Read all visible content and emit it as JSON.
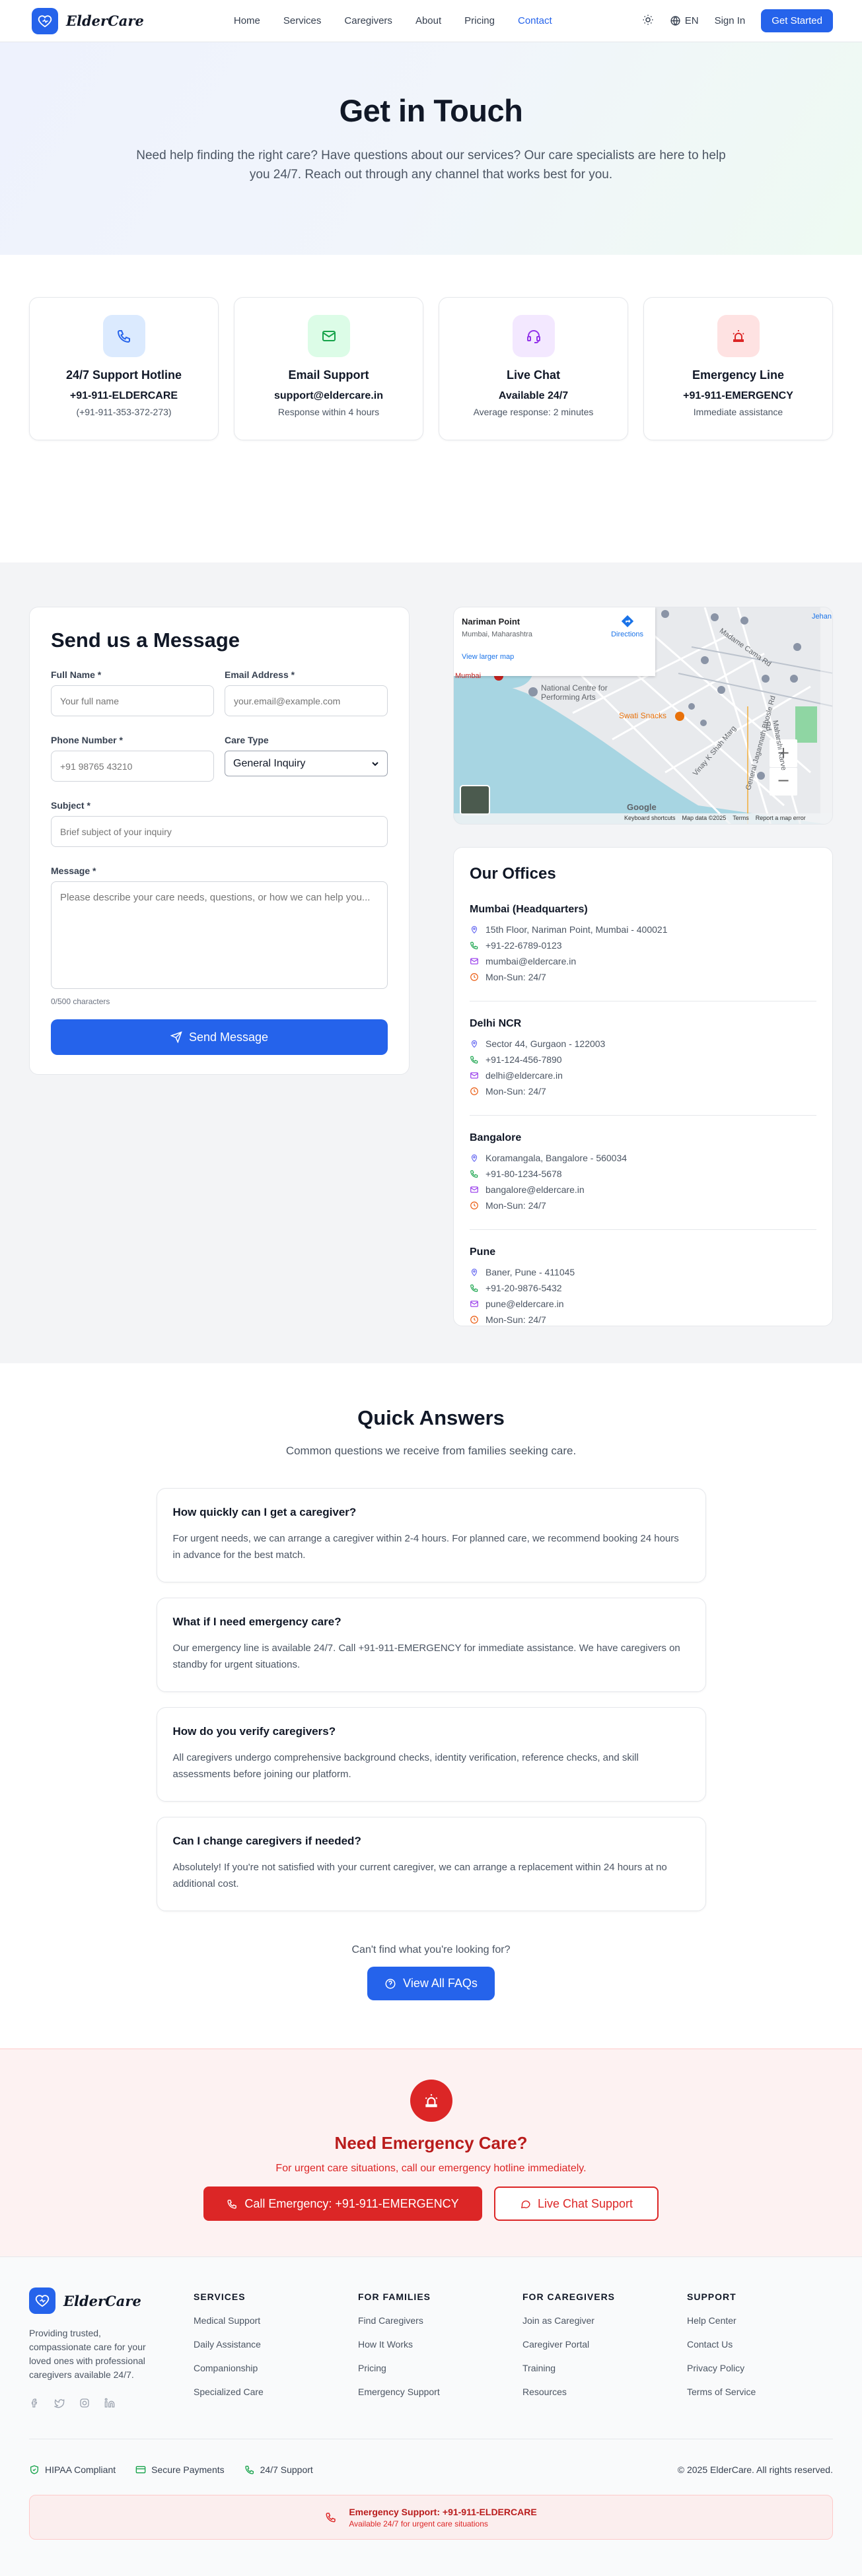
{
  "nav": {
    "brand": "ElderCare",
    "links": [
      "Home",
      "Services",
      "Caregivers",
      "About",
      "Pricing",
      "Contact"
    ],
    "lang": "EN",
    "signin": "Sign In",
    "cta": "Get Started"
  },
  "hero": {
    "title": "Get in Touch",
    "subtitle": "Need help finding the right care? Have questions about our services? Our care specialists are here to help you 24/7. Reach out through any channel that works best for you."
  },
  "cards": [
    {
      "title": "24/7 Support Hotline",
      "value": "+91-911-ELDERCARE",
      "sub": "(+91-911-353-372-273)",
      "icon": "phone-icon",
      "bg": "#dbeafe",
      "color": "#2563eb"
    },
    {
      "title": "Email Support",
      "value": "support@eldercare.in",
      "sub": "Response within 4 hours",
      "icon": "mail-icon",
      "bg": "#dcfce7",
      "color": "#16a34a"
    },
    {
      "title": "Live Chat",
      "value": "Available 24/7",
      "sub": "Average response: 2 minutes",
      "icon": "headset-icon",
      "bg": "#f3e8ff",
      "color": "#9333ea"
    },
    {
      "title": "Emergency Line",
      "value": "+91-911-EMERGENCY",
      "sub": "Immediate assistance",
      "icon": "siren-icon",
      "bg": "#fee2e2",
      "color": "#dc2626"
    }
  ],
  "form": {
    "title": "Send us a Message",
    "full_name_label": "Full Name *",
    "full_name_ph": "Your full name",
    "email_label": "Email Address *",
    "email_ph": "your.email@example.com",
    "phone_label": "Phone Number *",
    "phone_ph": "+91 98765 43210",
    "care_label": "Care Type",
    "care_value": "General Inquiry",
    "subject_label": "Subject *",
    "subject_ph": "Brief subject of your inquiry",
    "message_label": "Message *",
    "message_ph": "Please describe your care needs, questions, or how we can help you...",
    "counter": "0/500 characters",
    "send": "Send Message"
  },
  "map": {
    "place": "Nariman Point",
    "region": "Mumbai, Maharashtra",
    "directions": "Directions",
    "larger": "View larger map",
    "ncpa": "National Centre for Performing Arts",
    "swati": "Swati Snacks",
    "road1": "Madame Cama Rd",
    "road2": "Maharshi Karve Rd",
    "road3": "General Jagannath Bhosle Rd",
    "road4": "Vinay K Shah Marg",
    "jehan": "Jehan",
    "mumbai_label": "Mumbai",
    "google": "Google",
    "kb": "Keyboard shortcuts",
    "mapdata": "Map data ©2025",
    "terms": "Terms",
    "report": "Report a map error"
  },
  "offices": {
    "title": "Our Offices",
    "list": [
      {
        "name": "Mumbai (Headquarters)",
        "addr": "15th Floor, Nariman Point, Mumbai - 400021",
        "phone": "+91-22-6789-0123",
        "email": "mumbai@eldercare.in",
        "hours": "Mon-Sun: 24/7"
      },
      {
        "name": "Delhi NCR",
        "addr": "Sector 44, Gurgaon - 122003",
        "phone": "+91-124-456-7890",
        "email": "delhi@eldercare.in",
        "hours": "Mon-Sun: 24/7"
      },
      {
        "name": "Bangalore",
        "addr": "Koramangala, Bangalore - 560034",
        "phone": "+91-80-1234-5678",
        "email": "bangalore@eldercare.in",
        "hours": "Mon-Sun: 24/7"
      },
      {
        "name": "Pune",
        "addr": "Baner, Pune - 411045",
        "phone": "+91-20-9876-5432",
        "email": "pune@eldercare.in",
        "hours": "Mon-Sun: 24/7"
      }
    ]
  },
  "faq": {
    "title": "Quick Answers",
    "subtitle": "Common questions we receive from families seeking care.",
    "items": [
      {
        "q": "How quickly can I get a caregiver?",
        "a": "For urgent needs, we can arrange a caregiver within 2-4 hours. For planned care, we recommend booking 24 hours in advance for the best match."
      },
      {
        "q": "What if I need emergency care?",
        "a": "Our emergency line is available 24/7. Call +91-911-EMERGENCY for immediate assistance. We have caregivers on standby for urgent situations."
      },
      {
        "q": "How do you verify caregivers?",
        "a": "All caregivers undergo comprehensive background checks, identity verification, reference checks, and skill assessments before joining our platform."
      },
      {
        "q": "Can I change caregivers if needed?",
        "a": "Absolutely! If you're not satisfied with your current caregiver, we can arrange a replacement within 24 hours at no additional cost."
      }
    ],
    "more": "Can't find what you're looking for?",
    "button": "View All FAQs"
  },
  "emergency": {
    "title": "Need Emergency Care?",
    "text": "For urgent care situations, call our emergency hotline immediately.",
    "call": "Call Emergency: +91-911-EMERGENCY",
    "chat": "Live Chat Support"
  },
  "footer": {
    "brand": "ElderCare",
    "desc": "Providing trusted, compassionate care for your loved ones with professional caregivers available 24/7.",
    "cols": [
      {
        "title": "SERVICES",
        "links": [
          "Medical Support",
          "Daily Assistance",
          "Companionship",
          "Specialized Care"
        ]
      },
      {
        "title": "FOR FAMILIES",
        "links": [
          "Find Caregivers",
          "How It Works",
          "Pricing",
          "Emergency Support"
        ]
      },
      {
        "title": "FOR CAREGIVERS",
        "links": [
          "Join as Caregiver",
          "Caregiver Portal",
          "Training",
          "Resources"
        ]
      },
      {
        "title": "SUPPORT",
        "links": [
          "Help Center",
          "Contact Us",
          "Privacy Policy",
          "Terms of Service"
        ]
      }
    ],
    "badges": [
      "HIPAA Compliant",
      "Secure Payments",
      "24/7 Support"
    ],
    "copyright": "© 2025 ElderCare. All rights reserved.",
    "emer_title": "Emergency Support: +91-911-ELDERCARE",
    "emer_sub": "Available 24/7 for urgent care situations"
  }
}
